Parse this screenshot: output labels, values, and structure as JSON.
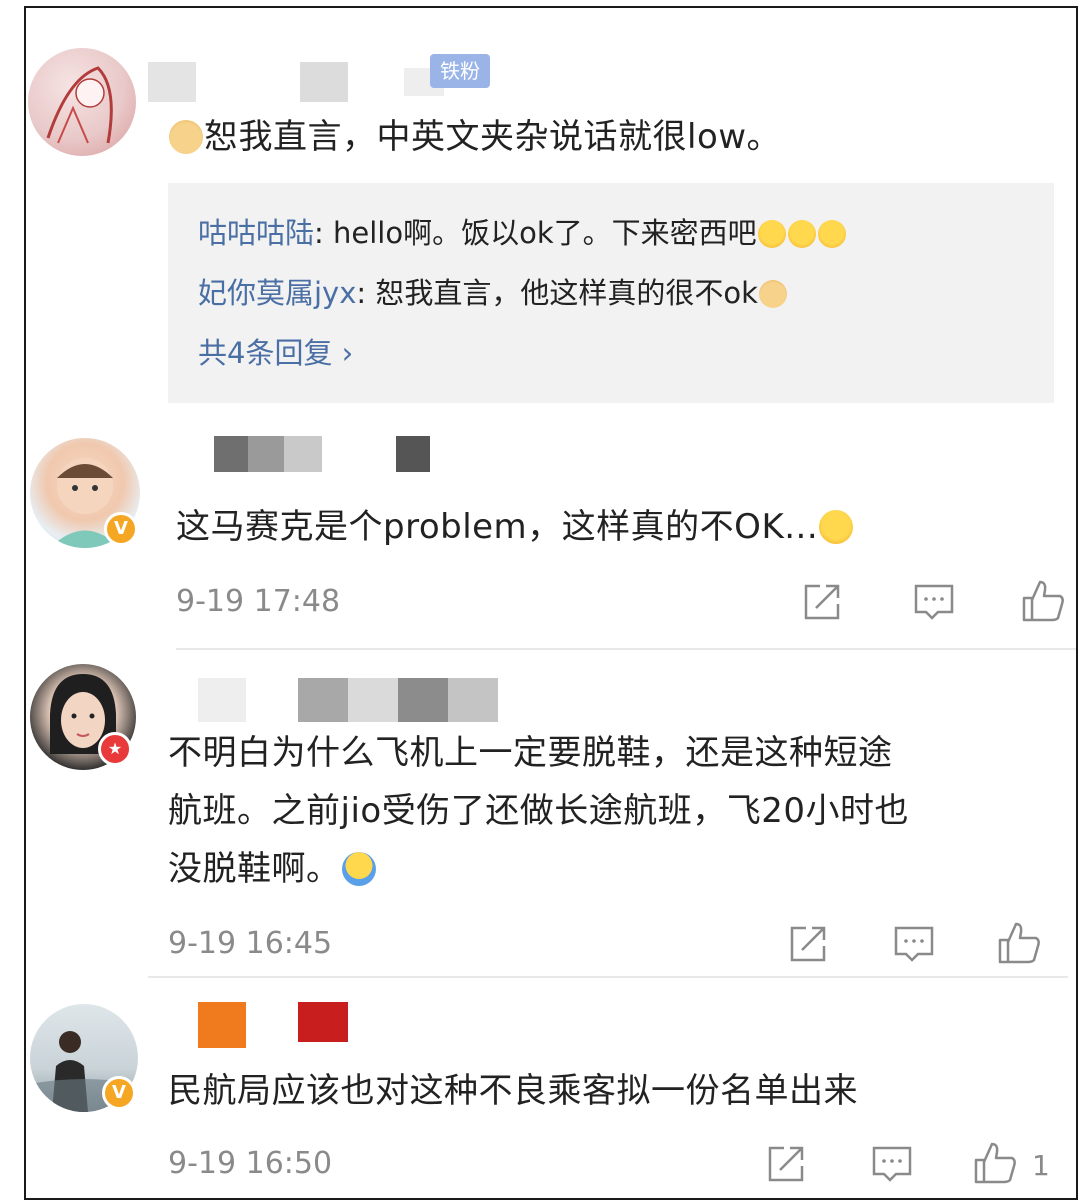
{
  "colors": {
    "name_link": "#4a6fa5",
    "timestamp": "#8a8a8a",
    "verified_badge": "#f5a623",
    "reply_box_bg": "#f2f2f2"
  },
  "comments": [
    {
      "fan_badge": "铁粉",
      "text": "恕我直言，中英文夹杂说话就很low。",
      "leading_emoji": "doge-emoji",
      "replies": [
        {
          "name": "咕咕咕陆",
          "text": ": hello啊。饭以ok了。下来密西吧",
          "trailing_emoji": "laugh-cry-emoji x3"
        },
        {
          "name": "妃你莫属jyx",
          "text": ": 恕我直言，他这样真的很不ok",
          "trailing_emoji": "doge-emoji"
        }
      ],
      "more_replies": "共4条回复 ›"
    },
    {
      "text": "这马赛克是个problem，这样真的不OK...",
      "trailing_emoji": "laugh-cry-emoji",
      "time": "9-19 17:48",
      "likes": ""
    },
    {
      "text_lines": [
        "不明白为什么飞机上一定要脱鞋，还是这种短途",
        "航班。之前jio受伤了还做长途航班，飞20小时也",
        "没脱鞋啊。"
      ],
      "trailing_emoji": "shrug-emoji",
      "time": "9-19 16:45",
      "likes": ""
    },
    {
      "text": "民航局应该也对这种不良乘客拟一份名单出来",
      "time": "9-19 16:50",
      "likes": "1"
    }
  ]
}
